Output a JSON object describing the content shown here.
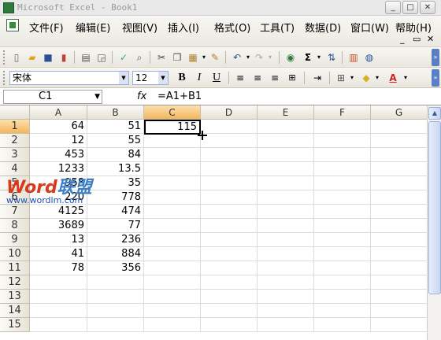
{
  "window": {
    "title": "Microsoft Excel - Book1",
    "min": "_",
    "max": "□",
    "close": "✕"
  },
  "menu": {
    "items": [
      "文件(F)",
      "编辑(E)",
      "视图(V)",
      "插入(I)",
      "格式(O)",
      "工具(T)",
      "数据(D)",
      "窗口(W)",
      "帮助(H)"
    ],
    "doc_controls": {
      "min": "_",
      "restore": "▭",
      "close": "✕"
    }
  },
  "format_bar": {
    "font": "宋体",
    "size": "12",
    "bold": "B",
    "italic": "I",
    "underline": "U"
  },
  "formula_bar": {
    "name_box": "C1",
    "fx": "fx",
    "formula": "=A1+B1"
  },
  "columns": [
    "A",
    "B",
    "C",
    "D",
    "E",
    "F",
    "G"
  ],
  "rows": [
    "1",
    "2",
    "3",
    "4",
    "5",
    "6",
    "7",
    "8",
    "9",
    "10",
    "11",
    "12",
    "13",
    "14",
    "15"
  ],
  "cells": {
    "A": [
      "64",
      "12",
      "453",
      "1233",
      "958",
      "220",
      "4125",
      "3689",
      "13",
      "41",
      "78"
    ],
    "B": [
      "51",
      "55",
      "84",
      "13.5",
      "35",
      "778",
      "474",
      "77",
      "236",
      "884",
      "356"
    ],
    "C": [
      "115"
    ]
  },
  "selected_cell": "C1",
  "watermark": {
    "brand_a": "Word",
    "brand_b": "联盟",
    "url": "www.wordlm.com"
  }
}
